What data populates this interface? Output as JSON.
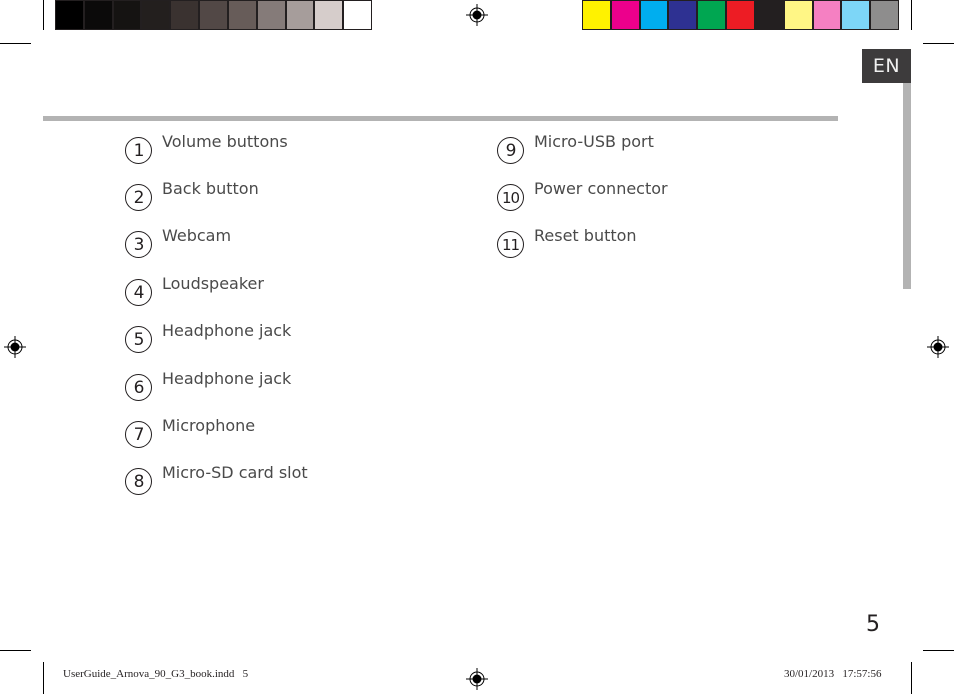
{
  "color_bars": {
    "grayscale": [
      "#000000",
      "#0b0a0a",
      "#151312",
      "#231f1e",
      "#3a3230",
      "#524846",
      "#675c59",
      "#857b79",
      "#a69d9b",
      "#d6cdcb",
      "#ffffff"
    ],
    "process": [
      "#fff200",
      "#ec008c",
      "#00aeef",
      "#2e3192",
      "#00a651",
      "#ed1c24",
      "#231f20",
      "#fff685",
      "#f580c2",
      "#7dd6f7",
      "#8e8d8d"
    ]
  },
  "language_tab": "EN",
  "items_left": [
    {
      "number": "1",
      "label": "Volume buttons"
    },
    {
      "number": "2",
      "label": "Back button"
    },
    {
      "number": "3",
      "label": "Webcam"
    },
    {
      "number": "4",
      "label": "Loudspeaker"
    },
    {
      "number": "5",
      "label": "Headphone jack"
    },
    {
      "number": "6",
      "label": "Headphone jack"
    },
    {
      "number": "7",
      "label": "Microphone"
    },
    {
      "number": "8",
      "label": "Micro-SD card slot"
    }
  ],
  "items_right": [
    {
      "number": "9",
      "label": "Micro-USB port"
    },
    {
      "number": "10",
      "label": "Power connector"
    },
    {
      "number": "11",
      "label": "Reset button"
    }
  ],
  "page_number": "5",
  "slug": {
    "filename": "UserGuide_Arnova_90_G3_book.indd   5",
    "timestamp": "30/01/2013   17:57:56"
  }
}
